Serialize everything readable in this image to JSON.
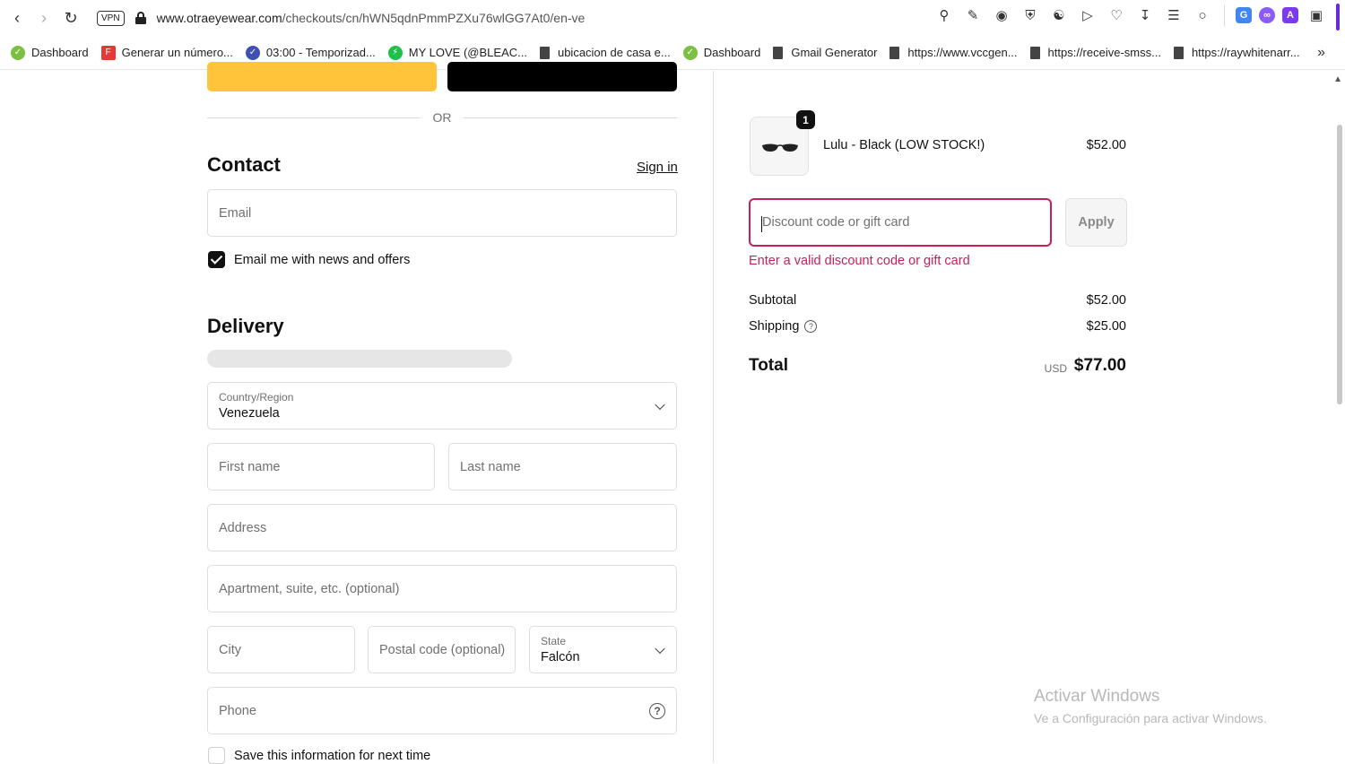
{
  "browser": {
    "vpn_label": "VPN",
    "url_host": "www.otraeyewear.com",
    "url_path": "/checkouts/cn/hWN5qdnPmmPZXu76wlGG7At0/en-ve",
    "bookmarks": [
      {
        "label": "Dashboard",
        "icon": "green-leaf-icon",
        "color": "#7bc043"
      },
      {
        "label": "Generar un número...",
        "icon": "f-brand-icon",
        "color": "#e53935"
      },
      {
        "label": "03:00 - Temporizad...",
        "icon": "check-circle-icon",
        "color": "#3f51b5"
      },
      {
        "label": "MY LOVE (@BLEAC...",
        "icon": "bolt-icon",
        "color": "#1fbf4a"
      },
      {
        "label": "ubicacion de casa e...",
        "icon": "document-icon",
        "color": "#444444"
      },
      {
        "label": "Dashboard",
        "icon": "green-leaf-icon",
        "color": "#7bc043"
      },
      {
        "label": "Gmail Generator",
        "icon": "document-icon",
        "color": "#444444"
      },
      {
        "label": "https://www.vccgen...",
        "icon": "document-icon",
        "color": "#444444"
      },
      {
        "label": "https://receive-smss...",
        "icon": "document-icon",
        "color": "#444444"
      },
      {
        "label": "https://raywhitenarr...",
        "icon": "document-icon",
        "color": "#444444"
      }
    ]
  },
  "checkout": {
    "or_label": "OR",
    "contact": {
      "heading": "Contact",
      "sign_in": "Sign in",
      "email_placeholder": "Email",
      "news_checkbox_label": "Email me with news and offers",
      "news_checked": true
    },
    "delivery": {
      "heading": "Delivery",
      "country_label": "Country/Region",
      "country_value": "Venezuela",
      "first_name_placeholder": "First name",
      "last_name_placeholder": "Last name",
      "address_placeholder": "Address",
      "apartment_placeholder": "Apartment, suite, etc. (optional)",
      "city_placeholder": "City",
      "postal_placeholder": "Postal code (optional)",
      "state_label": "State",
      "state_value": "Falcón",
      "phone_placeholder": "Phone",
      "save_info_label": "Save this information for next time",
      "save_info_checked": false
    }
  },
  "summary": {
    "item": {
      "quantity": "1",
      "name": "Lulu - Black (LOW STOCK!)",
      "price": "$52.00"
    },
    "discount_placeholder": "Discount code or gift card",
    "apply_label": "Apply",
    "discount_error": "Enter a valid discount code or gift card",
    "subtotal_label": "Subtotal",
    "subtotal_value": "$52.00",
    "shipping_label": "Shipping",
    "shipping_value": "$25.00",
    "total_label": "Total",
    "currency": "USD",
    "total_value": "$77.00",
    "error_color": "#c4215a"
  },
  "watermark": {
    "line1": "Activar Windows",
    "line2": "Ve a Configuración para activar Windows."
  }
}
